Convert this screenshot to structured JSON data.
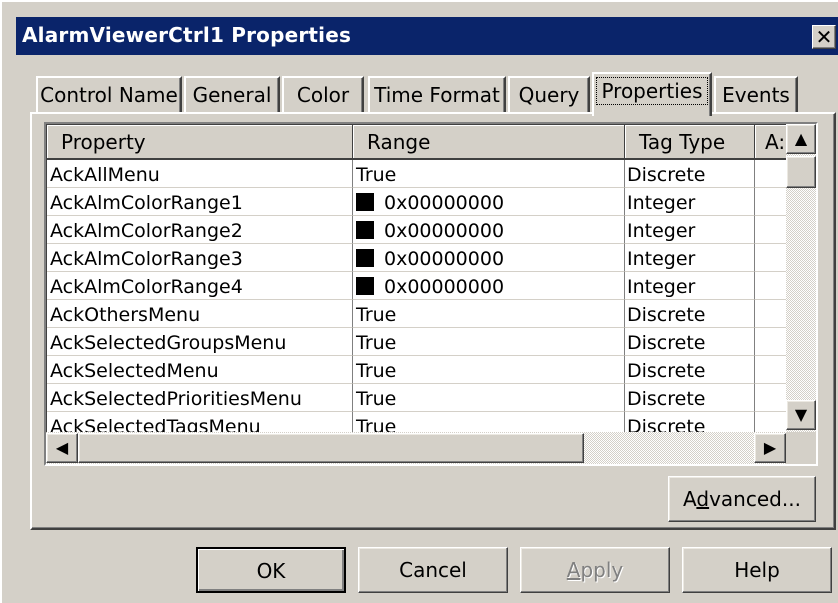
{
  "window": {
    "title": "AlarmViewerCtrl1 Properties",
    "close_glyph": "✕"
  },
  "tabs": [
    {
      "label": "Control Name",
      "active": false
    },
    {
      "label": "General",
      "active": false
    },
    {
      "label": "Color",
      "active": false
    },
    {
      "label": "Time Format",
      "active": false
    },
    {
      "label": "Query",
      "active": false
    },
    {
      "label": "Properties",
      "active": true
    },
    {
      "label": "Events",
      "active": false
    }
  ],
  "grid": {
    "columns": [
      "Property",
      "Range",
      "Tag Type",
      "A:"
    ],
    "rows": [
      {
        "property": "AckAllMenu",
        "range": "True",
        "swatch": false,
        "tag_type": "Discrete"
      },
      {
        "property": "AckAlmColorRange1",
        "range": "0x00000000",
        "swatch": true,
        "tag_type": "Integer"
      },
      {
        "property": "AckAlmColorRange2",
        "range": "0x00000000",
        "swatch": true,
        "tag_type": "Integer"
      },
      {
        "property": "AckAlmColorRange3",
        "range": "0x00000000",
        "swatch": true,
        "tag_type": "Integer"
      },
      {
        "property": "AckAlmColorRange4",
        "range": "0x00000000",
        "swatch": true,
        "tag_type": "Integer"
      },
      {
        "property": "AckOthersMenu",
        "range": "True",
        "swatch": false,
        "tag_type": "Discrete"
      },
      {
        "property": "AckSelectedGroupsMenu",
        "range": "True",
        "swatch": false,
        "tag_type": "Discrete"
      },
      {
        "property": "AckSelectedMenu",
        "range": "True",
        "swatch": false,
        "tag_type": "Discrete"
      },
      {
        "property": "AckSelectedPrioritiesMenu",
        "range": "True",
        "swatch": false,
        "tag_type": "Discrete"
      },
      {
        "property": "AckSelectedTagsMenu",
        "range": "True",
        "swatch": false,
        "tag_type": "Discrete"
      }
    ],
    "scroll_up_glyph": "▲",
    "scroll_down_glyph": "▼",
    "scroll_left_glyph": "◀",
    "scroll_right_glyph": "▶"
  },
  "buttons": {
    "advanced_pre": "A",
    "advanced_mnemonic": "d",
    "advanced_post": "vanced...",
    "ok": "OK",
    "cancel": "Cancel",
    "apply_mnemonic": "A",
    "apply_post": "pply",
    "help": "Help"
  },
  "colors": {
    "titlebar": "#0a246a",
    "dialog_face": "#d4d0c8",
    "swatch": "#000000"
  }
}
